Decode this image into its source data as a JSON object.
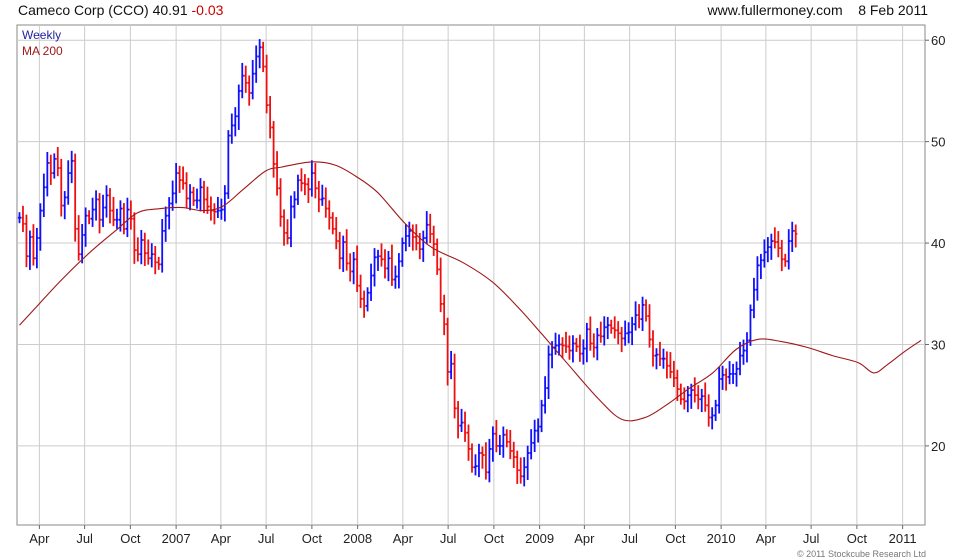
{
  "header": {
    "title": "Cameco Corp (CCO) 40.91",
    "change": "-0.03",
    "source": "www.fullermoney.com",
    "date": "8 Feb 2011"
  },
  "legend": {
    "weekly": "Weekly",
    "ma": "MA 200"
  },
  "credit": "© 2011 Stockcube Research Ltd",
  "colors": {
    "up": "#1010ff",
    "down": "#ee1010",
    "ma": "#a01818",
    "grid": "#cccccc"
  },
  "chart_data": {
    "type": "ohlc",
    "x_range": [
      "2006-02-15",
      "2011-02-15"
    ],
    "y_range": [
      12.2,
      61.5
    ],
    "y_ticks": [
      20,
      30,
      40,
      50,
      60
    ],
    "grid": true,
    "x_ticks": [
      {
        "date": "2006-04-01",
        "label": "Apr"
      },
      {
        "date": "2006-07-01",
        "label": "Jul"
      },
      {
        "date": "2006-10-01",
        "label": "Oct"
      },
      {
        "date": "2007-01-01",
        "label": "2007"
      },
      {
        "date": "2007-04-01",
        "label": "Apr"
      },
      {
        "date": "2007-07-01",
        "label": "Jul"
      },
      {
        "date": "2007-10-01",
        "label": "Oct"
      },
      {
        "date": "2008-01-01",
        "label": "2008"
      },
      {
        "date": "2008-04-01",
        "label": "Apr"
      },
      {
        "date": "2008-07-01",
        "label": "Jul"
      },
      {
        "date": "2008-10-01",
        "label": "Oct"
      },
      {
        "date": "2009-01-01",
        "label": "2009"
      },
      {
        "date": "2009-04-01",
        "label": "Apr"
      },
      {
        "date": "2009-07-01",
        "label": "Jul"
      },
      {
        "date": "2009-10-01",
        "label": "Oct"
      },
      {
        "date": "2010-01-01",
        "label": "2010"
      },
      {
        "date": "2010-04-01",
        "label": "Apr"
      },
      {
        "date": "2010-07-01",
        "label": "Jul"
      },
      {
        "date": "2010-10-01",
        "label": "Oct"
      },
      {
        "date": "2011-01-01",
        "label": "2011"
      }
    ],
    "price_series": {
      "name": "Weekly",
      "start": "2006-02-20",
      "interval_days": 7,
      "closes": [
        42.5,
        41.9,
        38.7,
        40.6,
        38.5,
        40.5,
        43.2,
        45.5,
        47.9,
        46.9,
        48.3,
        47.4,
        43.7,
        44.5,
        46.9,
        48.1,
        41.4,
        38.9,
        40.8,
        42.7,
        42.4,
        43.3,
        44.3,
        42.3,
        43.5,
        44.7,
        43.2,
        42.3,
        42.3,
        43.4,
        41.4,
        43.3,
        42.4,
        39.3,
        38.9,
        40.3,
        39.0,
        38.5,
        38.9,
        38.1,
        37.9,
        41.2,
        42.7,
        43.9,
        44.9,
        46.9,
        46.2,
        45.9,
        44.4,
        45.0,
        44.2,
        44.2,
        45.5,
        44.3,
        43.6,
        43.2,
        43.1,
        43.2,
        43.3,
        44.9,
        50.6,
        51.6,
        52.5,
        55.0,
        56.5,
        55.8,
        54.8,
        56.7,
        58.4,
        59.3,
        57.4,
        53.6,
        51.4,
        47.8,
        45.4,
        42.6,
        41.0,
        40.5,
        43.6,
        44.3,
        46.2,
        45.9,
        45.8,
        45.3,
        46.9,
        45.4,
        44.3,
        44.4,
        43.4,
        42.5,
        41.4,
        40.2,
        38.5,
        40.1,
        38.0,
        37.2,
        38.4,
        35.8,
        34.5,
        33.8,
        35.1,
        36.8,
        38.6,
        38.7,
        38.4,
        37.5,
        38.5,
        36.4,
        36.7,
        38.2,
        40.0,
        40.7,
        41.2,
        40.6,
        40.0,
        39.4,
        40.5,
        41.8,
        40.9,
        39.9,
        37.4,
        34.0,
        32.0,
        27.3,
        28.1,
        23.7,
        22.0,
        22.3,
        21.3,
        19.7,
        17.9,
        18.0,
        19.3,
        19.1,
        17.4,
        19.7,
        21.2,
        20.0,
        20.0,
        21.1,
        20.4,
        19.5,
        18.9,
        17.6,
        17.0,
        17.9,
        19.3,
        20.3,
        21.5,
        21.9,
        24.0,
        25.7,
        29.0,
        29.7,
        29.9,
        30.0,
        29.9,
        29.8,
        29.4,
        30.1,
        29.8,
        29.1,
        29.6,
        31.5,
        30.1,
        29.7,
        30.9,
        30.8,
        31.7,
        31.9,
        31.6,
        31.4,
        31.1,
        30.6,
        31.1,
        31.2,
        32.0,
        32.9,
        32.5,
        33.9,
        32.8,
        30.5,
        28.9,
        29.0,
        28.6,
        28.6,
        27.9,
        27.3,
        26.7,
        25.6,
        24.6,
        24.4,
        25.0,
        25.5,
        25.0,
        24.6,
        24.9,
        24.0,
        22.8,
        23.0,
        24.0,
        26.6,
        27.0,
        26.8,
        27.1,
        27.1,
        27.6,
        28.9,
        29.4,
        30.4,
        33.4,
        35.4,
        37.8,
        38.3,
        39.1,
        39.6,
        40.2,
        40.1,
        39.5,
        38.4,
        38.2,
        40.2,
        41.2,
        40.91
      ],
      "wick": 0.9
    },
    "ma_series": {
      "name": "MA 200",
      "points": [
        {
          "date": "2006-02-20",
          "value": 31.9
        },
        {
          "date": "2006-03-24",
          "value": 33.6
        },
        {
          "date": "2006-05-16",
          "value": 36.4
        },
        {
          "date": "2006-07-12",
          "value": 39.1
        },
        {
          "date": "2006-09-03",
          "value": 41.3
        },
        {
          "date": "2006-10-16",
          "value": 43.0
        },
        {
          "date": "2006-12-01",
          "value": 43.4
        },
        {
          "date": "2007-01-14",
          "value": 43.5
        },
        {
          "date": "2007-02-23",
          "value": 43.2
        },
        {
          "date": "2007-04-04",
          "value": 43.6
        },
        {
          "date": "2007-05-16",
          "value": 45.3
        },
        {
          "date": "2007-06-30",
          "value": 47.1
        },
        {
          "date": "2007-08-02",
          "value": 47.5
        },
        {
          "date": "2007-09-30",
          "value": 48.0
        },
        {
          "date": "2007-11-16",
          "value": 47.7
        },
        {
          "date": "2007-12-28",
          "value": 46.6
        },
        {
          "date": "2008-02-10",
          "value": 45.0
        },
        {
          "date": "2008-04-04",
          "value": 42.0
        },
        {
          "date": "2008-05-28",
          "value": 39.6
        },
        {
          "date": "2008-07-30",
          "value": 38.1
        },
        {
          "date": "2008-09-27",
          "value": 36.2
        },
        {
          "date": "2008-11-20",
          "value": 33.6
        },
        {
          "date": "2009-01-06",
          "value": 31.0
        },
        {
          "date": "2009-02-28",
          "value": 28.0
        },
        {
          "date": "2009-04-30",
          "value": 24.6
        },
        {
          "date": "2009-06-16",
          "value": 22.6
        },
        {
          "date": "2009-08-01",
          "value": 22.8
        },
        {
          "date": "2009-09-12",
          "value": 24.0
        },
        {
          "date": "2009-10-27",
          "value": 25.6
        },
        {
          "date": "2009-12-15",
          "value": 27.2
        },
        {
          "date": "2010-01-31",
          "value": 29.5
        },
        {
          "date": "2010-03-15",
          "value": 30.5
        },
        {
          "date": "2010-05-01",
          "value": 30.3
        },
        {
          "date": "2010-06-24",
          "value": 29.7
        },
        {
          "date": "2010-08-13",
          "value": 28.9
        },
        {
          "date": "2010-10-04",
          "value": 28.2
        },
        {
          "date": "2010-11-04",
          "value": 27.2
        },
        {
          "date": "2010-12-01",
          "value": 28.0
        },
        {
          "date": "2011-01-05",
          "value": 29.3
        },
        {
          "date": "2011-02-07",
          "value": 30.4
        }
      ]
    }
  }
}
